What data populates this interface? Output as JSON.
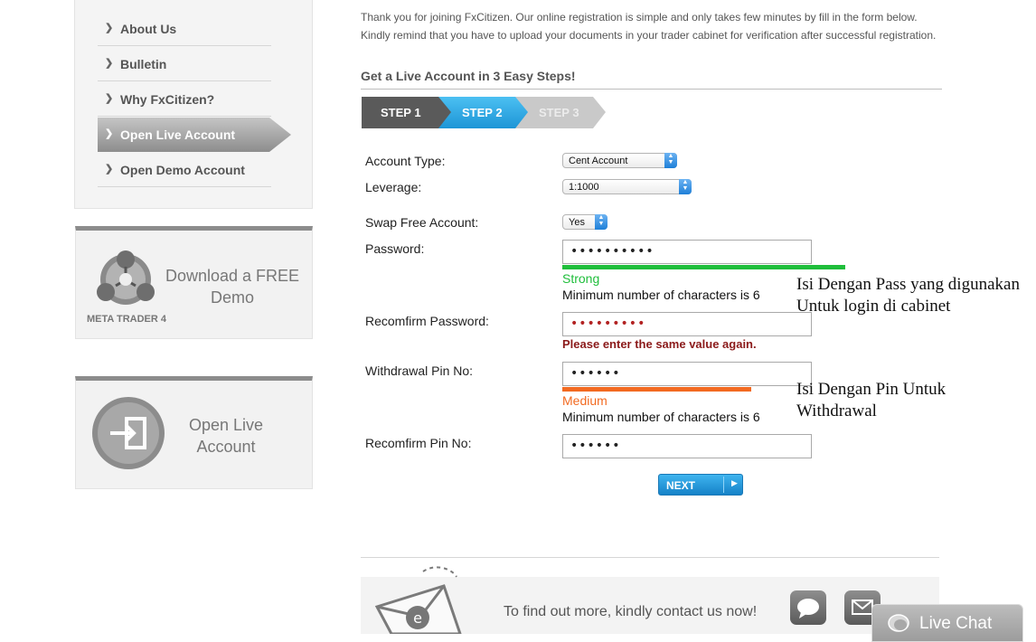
{
  "sidebar": {
    "items": [
      {
        "label": "About Us"
      },
      {
        "label": "Bulletin"
      },
      {
        "label": "Why FxCitizen?"
      },
      {
        "label": "Open Live Account"
      },
      {
        "label": "Open Demo Account"
      }
    ],
    "promo_mt4": {
      "title": "Download a FREE Demo",
      "line1": "Download a FREE",
      "line2": "Demo",
      "caption": "META TRADER 4"
    },
    "promo_live": {
      "line1": "Open Live",
      "line2": "Account"
    }
  },
  "intro": {
    "line1": "Thank you for joining FxCitizen. Our online registration is simple and only takes few minutes by fill in the form below.",
    "line2": "Kindly remind that you have to upload your documents in your trader cabinet for verification after successful registration."
  },
  "steps": {
    "heading": "Get a Live Account in 3 Easy Steps!",
    "items": [
      {
        "label": "STEP 1",
        "state": "done"
      },
      {
        "label": "STEP 2",
        "state": "active"
      },
      {
        "label": "STEP 3",
        "state": "pending"
      }
    ]
  },
  "form": {
    "account_type": {
      "label": "Account Type:",
      "value": "Cent Account"
    },
    "leverage": {
      "label": "Leverage:",
      "value": "1:1000"
    },
    "swap_free": {
      "label": "Swap Free Account:",
      "value": "Yes"
    },
    "password": {
      "label": "Password:",
      "value": "••••••••••",
      "strength": "Strong",
      "strength_color": "#1fbe3b",
      "hint": "Minimum number of characters is 6"
    },
    "confirm_password": {
      "label": "Recomfirm Password:",
      "value": "•••••••••",
      "error": "Please enter the same value again.",
      "value_color": "#b22222"
    },
    "withdrawal_pin": {
      "label": "Withdrawal Pin No:",
      "value": "••••••",
      "strength": "Medium",
      "strength_color": "#f26a21",
      "hint": "Minimum number of characters is 6"
    },
    "confirm_pin": {
      "label": "Recomfirm Pin No:",
      "value": "••••••"
    },
    "next_label": "NEXT"
  },
  "annotations": {
    "password_note_line1": "Isi Dengan Pass yang digunakan",
    "password_note_line2": "Untuk login di cabinet",
    "pin_note_line1": "Isi Dengan Pin Untuk",
    "pin_note_line2": "Withdrawal"
  },
  "contact": {
    "text": "To find out more, kindly contact us now!"
  },
  "live_chat": {
    "label": "Live Chat"
  },
  "colors": {
    "accent_blue": "#2aa3e3",
    "error_red": "#8b1a1a",
    "strong_green": "#1fbe3b",
    "medium_orange": "#f26a21"
  }
}
